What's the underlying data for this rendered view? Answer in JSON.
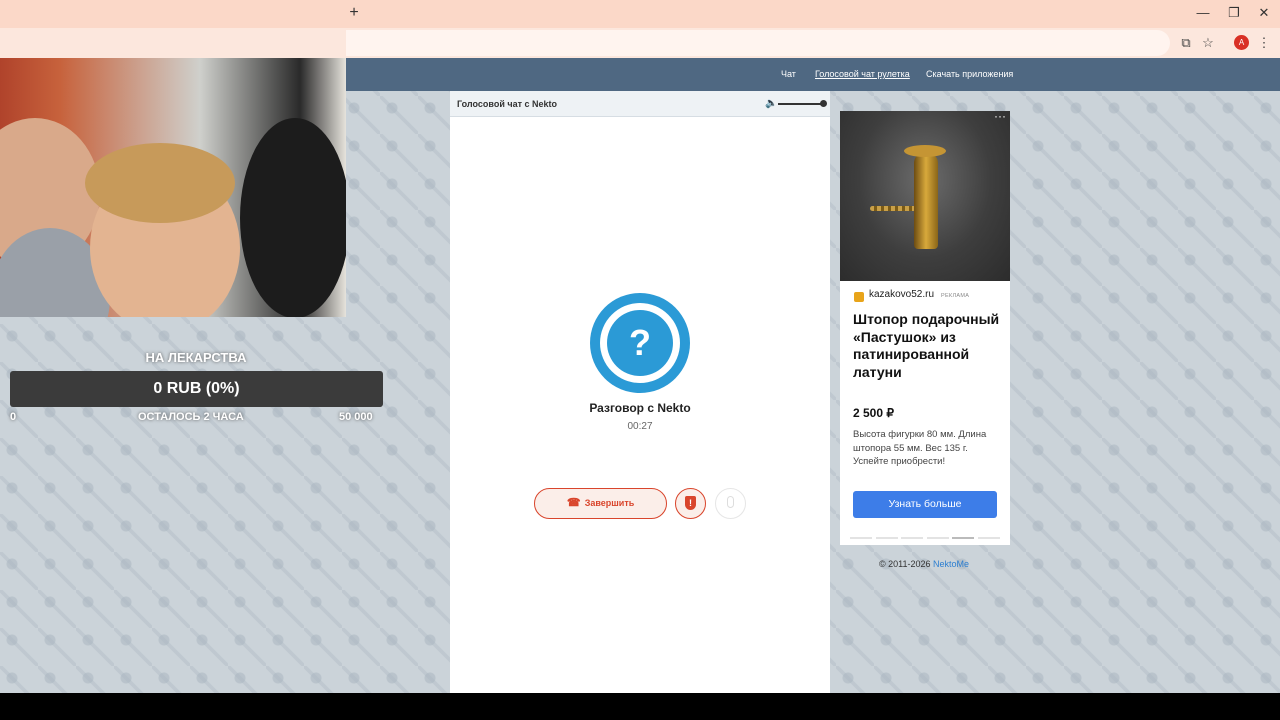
{
  "browser": {
    "new_tab": "+",
    "window_minimize": "—",
    "window_restore": "❐",
    "window_close": "✕",
    "profile_initial": "A"
  },
  "nav": {
    "items": [
      "Чат",
      "Голосовой чат рулетка",
      "Скачать приложения"
    ],
    "active_index": 1
  },
  "donation": {
    "title": "НА ЛЕКАРСТВА",
    "amount": "0 RUB (0%)",
    "min": "0",
    "remaining": "ОСТАЛОСЬ 2 ЧАСА",
    "goal": "50 000",
    "progress": 0
  },
  "chat": {
    "header_title": "Голосовой чат с Nekto",
    "volume_level": 1.0,
    "avatar_glyph": "?",
    "conversation_title": "Разговор с Nekto",
    "timer": "00:27",
    "end_button": "Завершить",
    "shield_glyph": "!"
  },
  "ad": {
    "domain": "kazakovo52.ru",
    "label": "РЕКЛАМА",
    "title": "Штопор подарочный «Пастушок» из патинированной латуни",
    "price": "2 500 ₽",
    "description": "Высота фигурки 80 мм. Длина штопора 55 мм. Вес 135 г. Успейте приобрести!",
    "button": "Узнать больше",
    "more_glyph": "···",
    "slides_count": 6,
    "active_slide": 4
  },
  "footer": {
    "copyright": "© 2011-2026 ",
    "link": "NektoMe"
  },
  "colors": {
    "nav_bg": "#4f6882",
    "accent_blue": "#2b9ad6",
    "end_red": "#d9452c",
    "ad_button": "#3d7de8"
  }
}
